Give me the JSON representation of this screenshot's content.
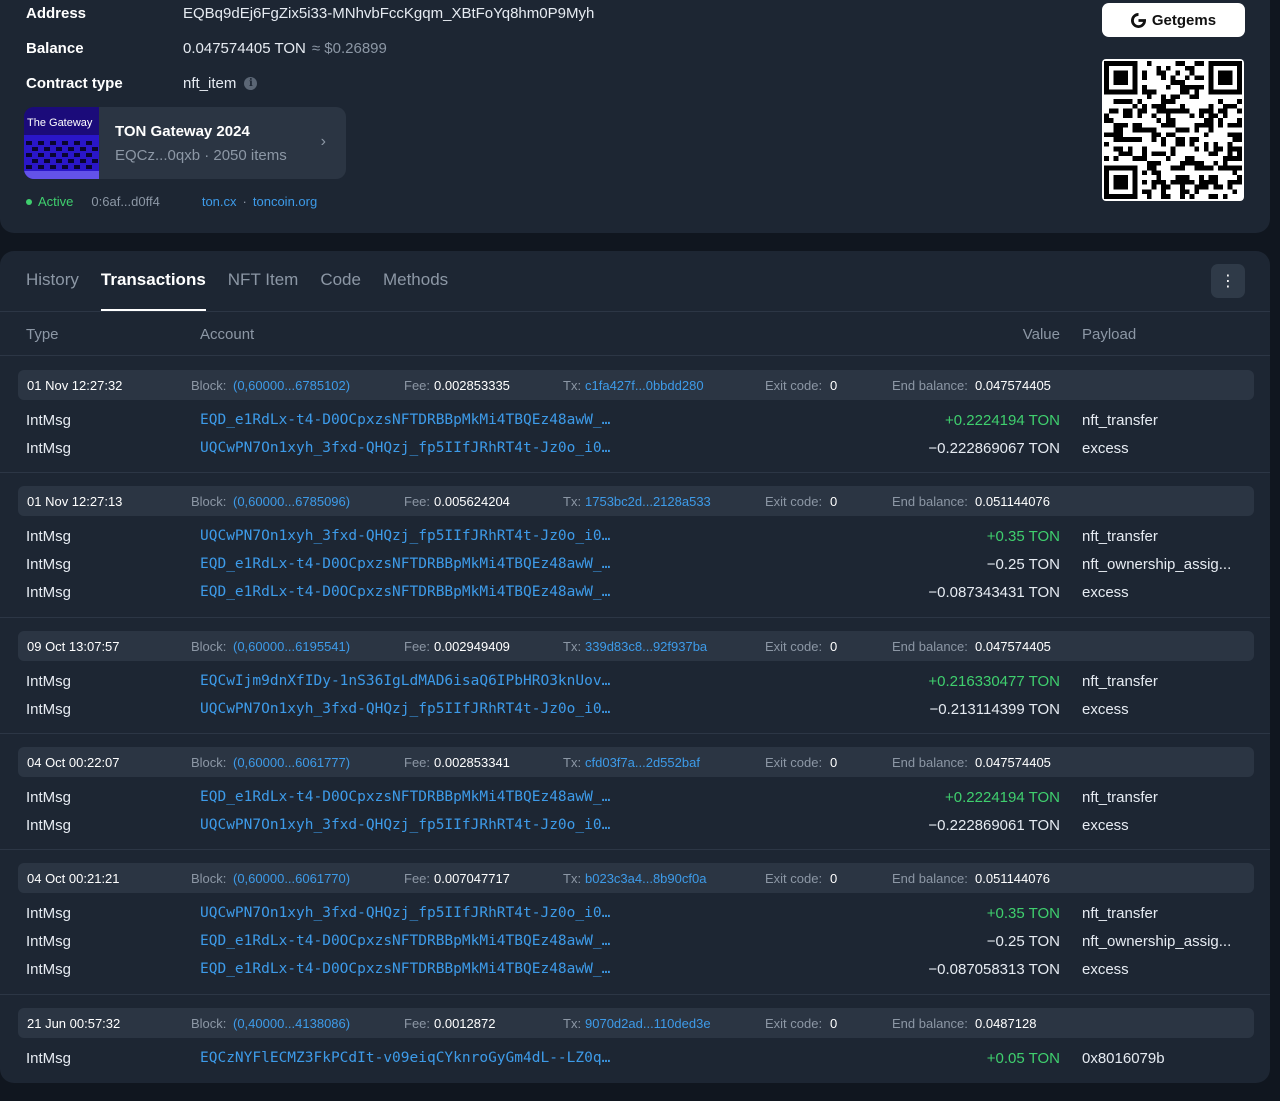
{
  "info": {
    "address_label": "Address",
    "address": "EQBq9dEj6FgZix5i33-MNhvbFccKgqm_XBtFoYq8hm0P9Myh",
    "balance_label": "Balance",
    "balance": "0.047574405 TON",
    "balance_usd": "≈ $0.26899",
    "contract_label": "Contract type",
    "contract_type": "nft_item",
    "info_icon_glyph": "i"
  },
  "collection": {
    "thumb_caption": "The Gateway",
    "title": "TON Gateway 2024",
    "subtitle": "EQCz...0qxb · 2050 items",
    "chevron": "›"
  },
  "status": {
    "state": "Active",
    "code_hash": "0:6af...d0ff4",
    "link1": "ton.cx",
    "sep": "·",
    "link2": "toncoin.org"
  },
  "getgems": {
    "label": "Getgems"
  },
  "tabs": [
    "History",
    "Transactions",
    "NFT Item",
    "Code",
    "Methods"
  ],
  "menu_glyph": "⋮",
  "columns": {
    "type": "Type",
    "account": "Account",
    "value": "Value",
    "payload": "Payload"
  },
  "labels": {
    "block": "Block:",
    "fee": "Fee:",
    "tx": "Tx:",
    "exit": "Exit code:",
    "end_balance": "End balance:"
  },
  "transactions": [
    {
      "date": "01 Nov 12:27:32",
      "block": "(0,60000...6785102)",
      "fee": "0.002853335",
      "tx": "c1fa427f...0bbdd280",
      "exit": "0",
      "end": "0.047574405",
      "rows": [
        {
          "type": "IntMsg",
          "account": "EQD_e1RdLx-t4-D0OCpxzsNFTDRBBpMkMi4TBQEz48awW_…",
          "value": "+0.2224194 TON",
          "dir": "in",
          "payload": "nft_transfer"
        },
        {
          "type": "IntMsg",
          "account": "UQCwPN7On1xyh_3fxd-QHQzj_fp5IIfJRhRT4t-Jz0o_i0…",
          "value": "−0.222869067 TON",
          "dir": "out",
          "payload": "excess"
        }
      ]
    },
    {
      "date": "01 Nov 12:27:13",
      "block": "(0,60000...6785096)",
      "fee": "0.005624204",
      "tx": "1753bc2d...2128a533",
      "exit": "0",
      "end": "0.051144076",
      "rows": [
        {
          "type": "IntMsg",
          "account": "UQCwPN7On1xyh_3fxd-QHQzj_fp5IIfJRhRT4t-Jz0o_i0…",
          "value": "+0.35 TON",
          "dir": "in",
          "payload": "nft_transfer"
        },
        {
          "type": "IntMsg",
          "account": "EQD_e1RdLx-t4-D0OCpxzsNFTDRBBpMkMi4TBQEz48awW_…",
          "value": "−0.25 TON",
          "dir": "out",
          "payload": "nft_ownership_assig..."
        },
        {
          "type": "IntMsg",
          "account": "EQD_e1RdLx-t4-D0OCpxzsNFTDRBBpMkMi4TBQEz48awW_…",
          "value": "−0.087343431 TON",
          "dir": "out",
          "payload": "excess"
        }
      ]
    },
    {
      "date": "09 Oct 13:07:57",
      "block": "(0,60000...6195541)",
      "fee": "0.002949409",
      "tx": "339d83c8...92f937ba",
      "exit": "0",
      "end": "0.047574405",
      "rows": [
        {
          "type": "IntMsg",
          "account": "EQCwIjm9dnXfIDy-1nS36IgLdMAD6isaQ6IPbHRO3knUov…",
          "value": "+0.216330477 TON",
          "dir": "in",
          "payload": "nft_transfer"
        },
        {
          "type": "IntMsg",
          "account": "UQCwPN7On1xyh_3fxd-QHQzj_fp5IIfJRhRT4t-Jz0o_i0…",
          "value": "−0.213114399 TON",
          "dir": "out",
          "payload": "excess"
        }
      ]
    },
    {
      "date": "04 Oct 00:22:07",
      "block": "(0,60000...6061777)",
      "fee": "0.002853341",
      "tx": "cfd03f7a...2d552baf",
      "exit": "0",
      "end": "0.047574405",
      "rows": [
        {
          "type": "IntMsg",
          "account": "EQD_e1RdLx-t4-D0OCpxzsNFTDRBBpMkMi4TBQEz48awW_…",
          "value": "+0.2224194 TON",
          "dir": "in",
          "payload": "nft_transfer"
        },
        {
          "type": "IntMsg",
          "account": "UQCwPN7On1xyh_3fxd-QHQzj_fp5IIfJRhRT4t-Jz0o_i0…",
          "value": "−0.222869061 TON",
          "dir": "out",
          "payload": "excess"
        }
      ]
    },
    {
      "date": "04 Oct 00:21:21",
      "block": "(0,60000...6061770)",
      "fee": "0.007047717",
      "tx": "b023c3a4...8b90cf0a",
      "exit": "0",
      "end": "0.051144076",
      "rows": [
        {
          "type": "IntMsg",
          "account": "UQCwPN7On1xyh_3fxd-QHQzj_fp5IIfJRhRT4t-Jz0o_i0…",
          "value": "+0.35 TON",
          "dir": "in",
          "payload": "nft_transfer"
        },
        {
          "type": "IntMsg",
          "account": "EQD_e1RdLx-t4-D0OCpxzsNFTDRBBpMkMi4TBQEz48awW_…",
          "value": "−0.25 TON",
          "dir": "out",
          "payload": "nft_ownership_assig..."
        },
        {
          "type": "IntMsg",
          "account": "EQD_e1RdLx-t4-D0OCpxzsNFTDRBBpMkMi4TBQEz48awW_…",
          "value": "−0.087058313 TON",
          "dir": "out",
          "payload": "excess"
        }
      ]
    },
    {
      "date": "21 Jun 00:57:32",
      "block": "(0,40000...4138086)",
      "fee": "0.0012872",
      "tx": "9070d2ad...110ded3e",
      "exit": "0",
      "end": "0.0487128",
      "rows": [
        {
          "type": "IntMsg",
          "account": "EQCzNYFlECMZ3FkPCdIt-v09eiqCYknroGyGm4dL--LZ0q…",
          "value": "+0.05 TON",
          "dir": "in",
          "payload": "0x8016079b"
        }
      ]
    }
  ],
  "colors": {
    "bg": "#10161f",
    "card": "#1d2633",
    "link": "#3d9be9",
    "positive": "#3fcf6e"
  }
}
